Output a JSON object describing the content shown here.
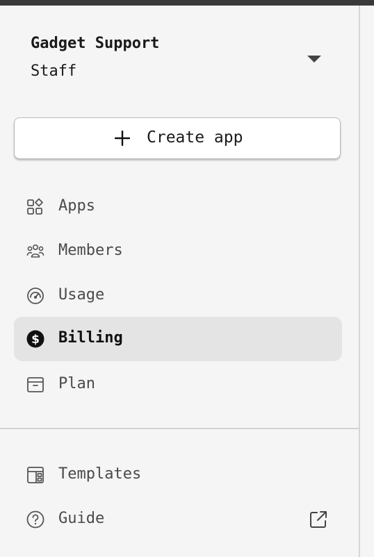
{
  "org": {
    "name": "Gadget Support",
    "role": "Staff"
  },
  "create_button": {
    "label": "Create app"
  },
  "nav": {
    "items": [
      {
        "label": "Apps",
        "icon": "apps-icon"
      },
      {
        "label": "Members",
        "icon": "members-icon"
      },
      {
        "label": "Usage",
        "icon": "speedometer-icon"
      },
      {
        "label": "Billing",
        "icon": "dollar-icon",
        "active": true
      },
      {
        "label": "Plan",
        "icon": "box-icon"
      }
    ]
  },
  "footer_nav": {
    "items": [
      {
        "label": "Templates",
        "icon": "templates-icon"
      },
      {
        "label": "Guide",
        "icon": "help-circle-icon",
        "trailing_icon": "external-link-icon"
      }
    ]
  },
  "colors": {
    "background": "#f5f5f5",
    "active_item_bg": "#e4e4e4",
    "text_primary": "#1a1a1a",
    "text_secondary": "#4a4a4a",
    "topbar": "#3a3a3a"
  }
}
